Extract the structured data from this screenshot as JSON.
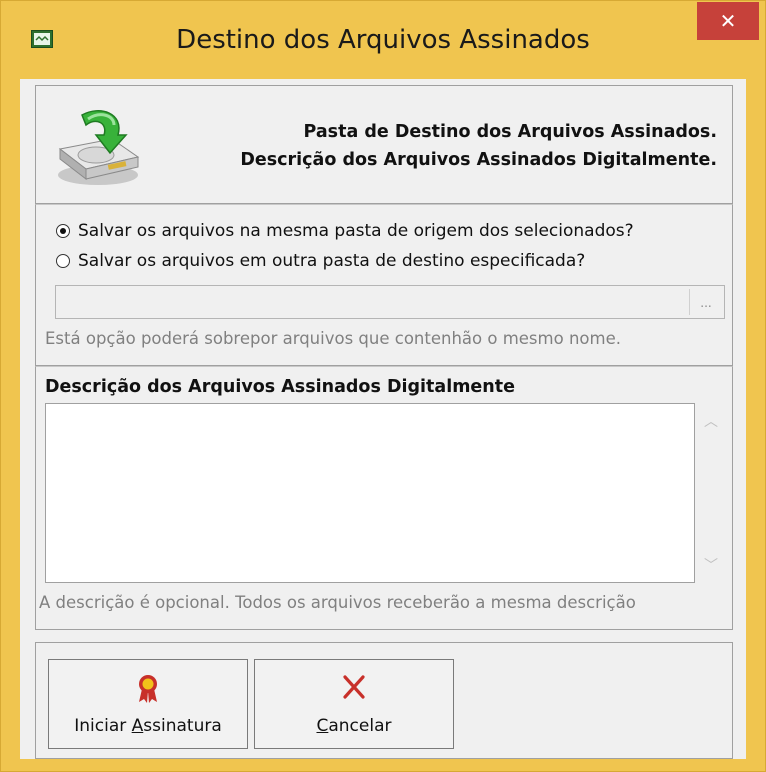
{
  "window": {
    "title": "Destino dos Arquivos Assinados",
    "close_glyph": "✕"
  },
  "header": {
    "line1": "Pasta de Destino dos Arquivos Assinados.",
    "line2": "Descrição dos Arquivos Assinados Digitalmente.",
    "icon": "drive-download-icon"
  },
  "destination": {
    "option_same": "Salvar os arquivos na mesma pasta de origem dos selecionados?",
    "option_other": "Salvar os arquivos em outra pasta de destino especificada?",
    "selected": "option_same",
    "path_value": "",
    "browse_label": "...",
    "warning": "Está opção poderá sobrepor arquivos que contenhão o mesmo nome."
  },
  "description": {
    "label": "Descrição dos Arquivos Assinados Digitalmente",
    "value": "",
    "hint": "A descrição é opcional. Todos os arquivos receberão a mesma descrição"
  },
  "buttons": {
    "start": {
      "prefix": "Iniciar ",
      "mnemonic": "A",
      "suffix": "ssinatura",
      "icon": "ribbon-award-icon"
    },
    "cancel": {
      "prefix": "",
      "mnemonic": "C",
      "suffix": "ancelar",
      "icon": "red-x-icon"
    }
  },
  "colors": {
    "window_frame": "#f0c54f",
    "close_button": "#c6413a",
    "client_bg": "#f0f0f0"
  }
}
